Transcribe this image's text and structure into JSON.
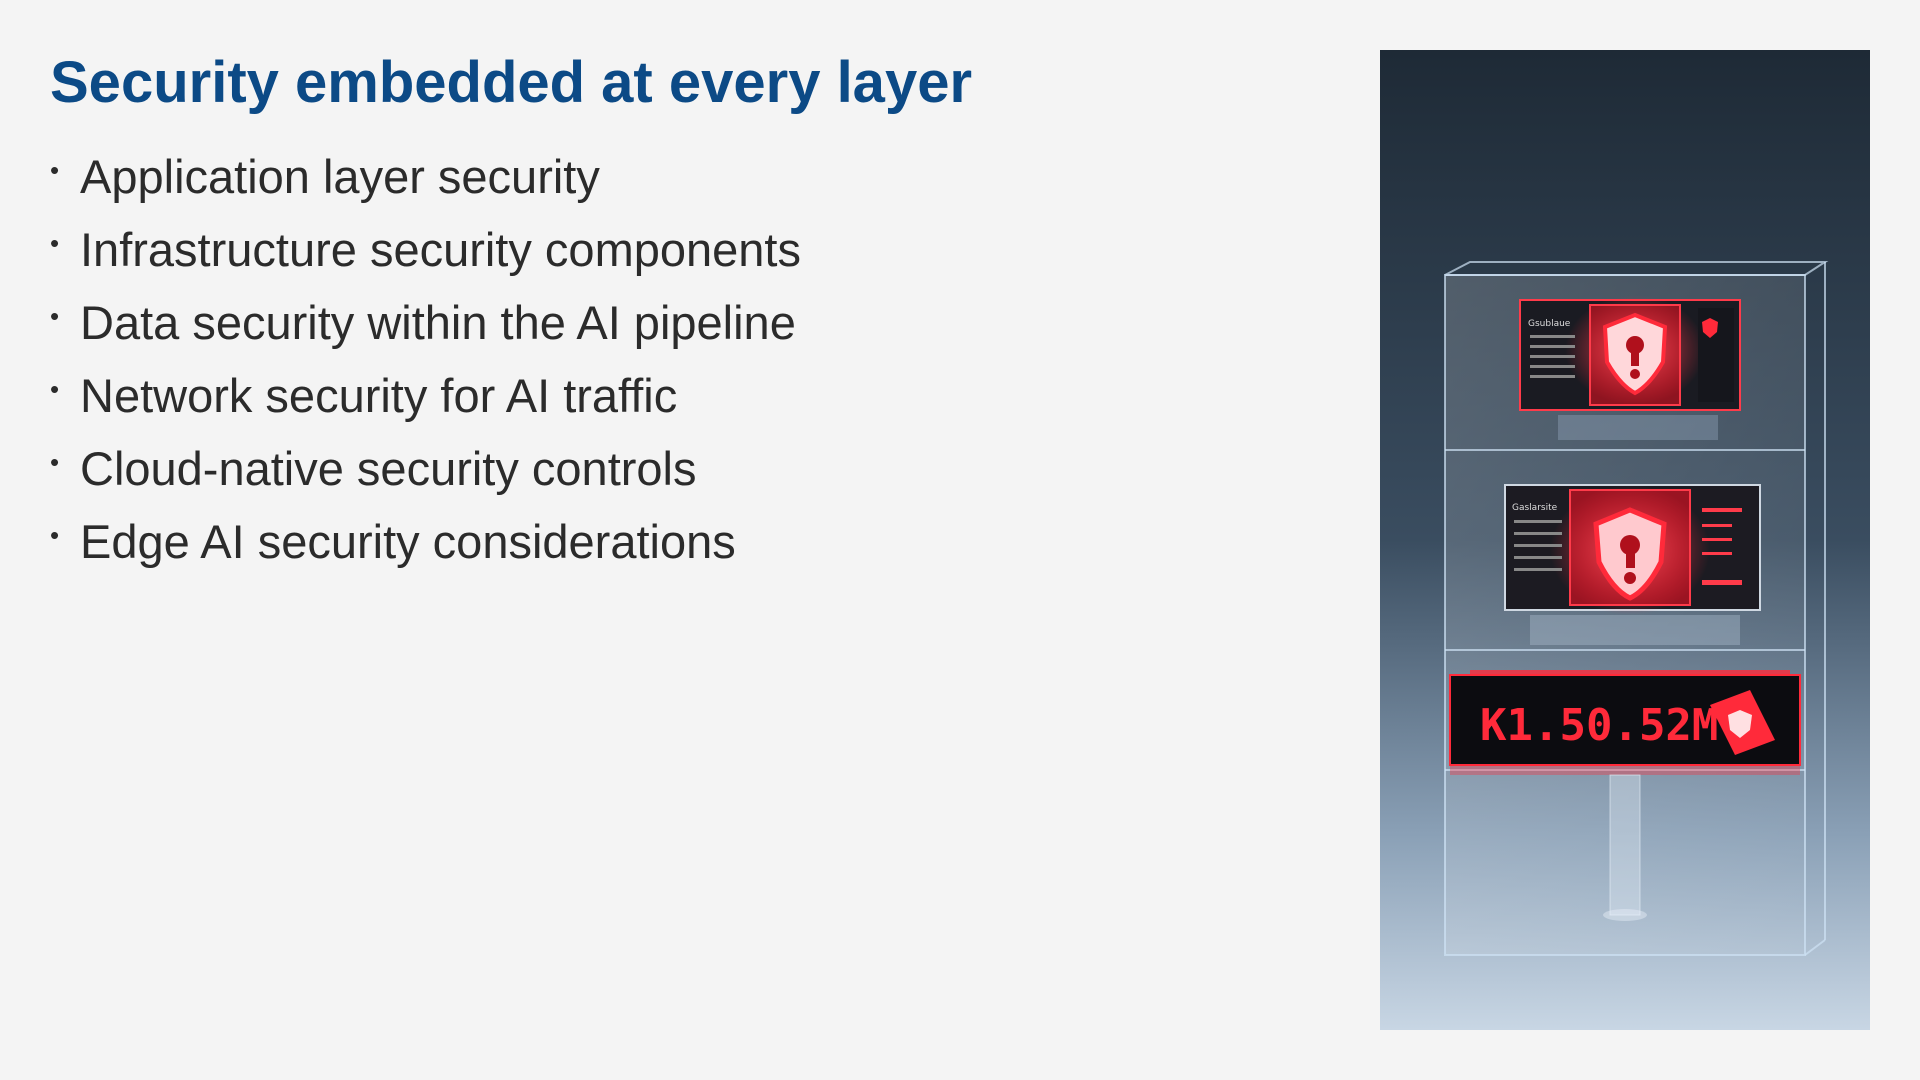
{
  "slide": {
    "title": "Security embedded at every layer",
    "bullets": [
      "Application layer security",
      "Infrastructure security components",
      "Data security within the AI pipeline",
      "Network security for AI traffic",
      "Cloud-native security controls",
      "Edge AI security considerations"
    ]
  },
  "image": {
    "display_text": "K1.50.52M",
    "panel_header_1": "Gsublaue",
    "panel_header_2": "Gaslarsite",
    "icons": [
      "shield-alert-icon",
      "shield-alert-icon",
      "shield-alert-icon"
    ]
  },
  "colors": {
    "title": "#0c4a86",
    "text": "#2b2b2b",
    "background": "#f4f4f4",
    "alert_red": "#ff2a3a"
  }
}
